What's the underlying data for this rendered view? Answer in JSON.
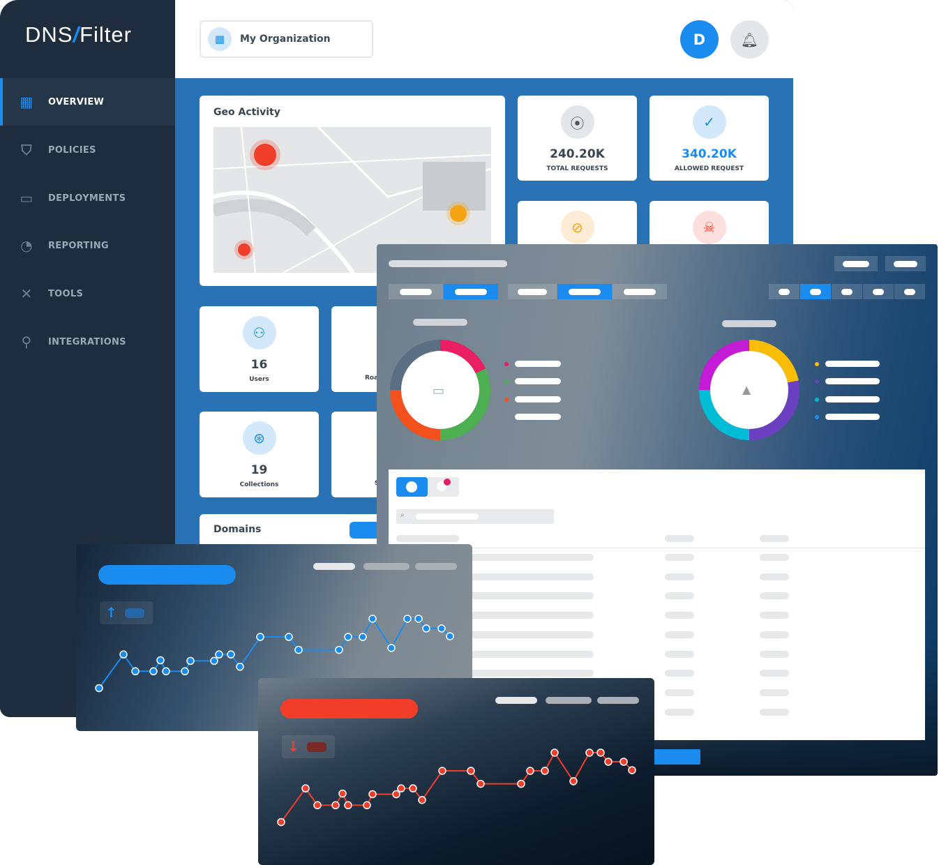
{
  "brand": {
    "logo": "DNSFilter"
  },
  "sidebar": {
    "items": [
      {
        "label": "OVERVIEW",
        "icon": "dashboard-icon",
        "active": true
      },
      {
        "label": "POLICIES",
        "icon": "shield-icon"
      },
      {
        "label": "DEPLOYMENTS",
        "icon": "devices-icon"
      },
      {
        "label": "REPORTING",
        "icon": "pie-chart-icon"
      },
      {
        "label": "TOOLS",
        "icon": "tools-icon"
      },
      {
        "label": "INTEGRATIONS",
        "icon": "plug-icon"
      }
    ]
  },
  "header": {
    "org": "My Organization",
    "avatar": "D"
  },
  "geo": {
    "title": "Geo Activity"
  },
  "stats": [
    {
      "value": "240.20K",
      "label": "TOTAL REQUESTS",
      "icon": "antenna-icon"
    },
    {
      "value": "340.20K",
      "label": "ALLOWED REQUEST",
      "icon": "check-icon"
    }
  ],
  "stats_row2_icons": [
    "blocked-icon",
    "threat-icon"
  ],
  "counts": [
    {
      "value": "16",
      "label": "Users",
      "icon": "user-icon"
    },
    {
      "value": "19",
      "label": "Collections",
      "icon": "collection-icon"
    }
  ],
  "partial_labels": [
    "Roa",
    "S"
  ],
  "domains": {
    "title": "Domains"
  },
  "colors": {
    "accent": "#1a8cf0",
    "sidebar": "#1e2d3d",
    "content": "#2872b5",
    "up": "#1a8cf0",
    "down": "#f03e2a"
  },
  "donuts": [
    {
      "segments": [
        {
          "color": "#e91e63",
          "value": 18
        },
        {
          "color": "#4caf50",
          "value": 32
        },
        {
          "color": "#f4511e",
          "value": 25
        },
        {
          "color": "#5b6f82",
          "value": 25
        }
      ],
      "center_icon": "devices-icon"
    },
    {
      "segments": [
        {
          "color": "#fbbc05",
          "value": 22
        },
        {
          "color": "#6a3fc0",
          "value": 28
        },
        {
          "color": "#00bcd4",
          "value": 25
        },
        {
          "color": "#c51bd6",
          "value": 25
        }
      ],
      "center_icon": "shapes-icon"
    }
  ],
  "trend_up": {
    "values": [
      7,
      59,
      33,
      33,
      50,
      33,
      33,
      49,
      49,
      59,
      59,
      40,
      86,
      86,
      66,
      66,
      86,
      86,
      114,
      69,
      114,
      114,
      99,
      99,
      87
    ],
    "icon": "arrow-up-icon"
  },
  "trend_down": {
    "values": [
      7,
      59,
      33,
      33,
      51,
      33,
      33,
      50,
      50,
      59,
      59,
      41,
      86,
      86,
      66,
      66,
      86,
      86,
      114,
      70,
      114,
      114,
      100,
      100,
      87
    ],
    "icon": "arrow-down-icon"
  }
}
